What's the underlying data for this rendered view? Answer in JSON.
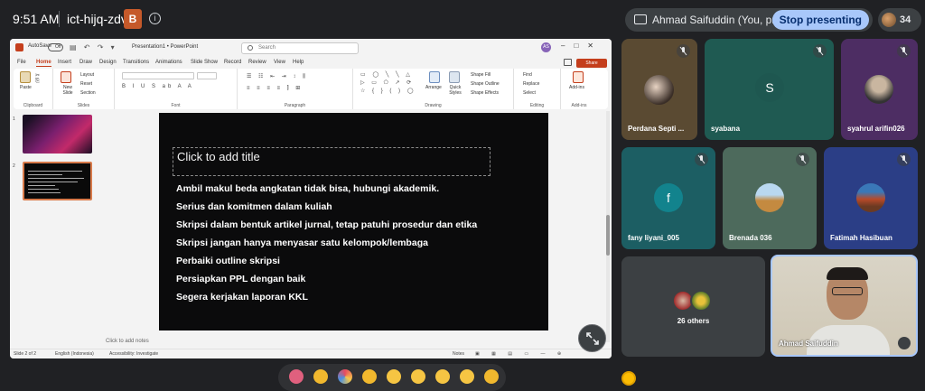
{
  "meeting": {
    "time": "9:51 AM",
    "code": "ict-hijq-zdv",
    "badge": "B",
    "presenting_text": "Ahmad Saifuddin (You, presenting)",
    "stop_label": "Stop presenting",
    "participant_count": "34"
  },
  "ppt": {
    "autosave": "AutoSave",
    "autosave_state": "Off",
    "doc_title": "Presentation1 • PowerPoint",
    "search_placeholder": "Search",
    "avatar": "AS",
    "tabs": [
      "File",
      "Home",
      "Insert",
      "Draw",
      "Design",
      "Transitions",
      "Animations",
      "Slide Show",
      "Record",
      "Review",
      "View",
      "Help"
    ],
    "share": "Share",
    "ribbon": {
      "clipboard": "Clipboard",
      "paste": "Paste",
      "slides": "Slides",
      "new_slide": "New Slide",
      "layout": "Layout",
      "reset": "Reset",
      "section": "Section",
      "font": "Font",
      "paragraph": "Paragraph",
      "drawing": "Drawing",
      "arrange": "Arrange",
      "quick_styles": "Quick Styles",
      "shape_fill": "Shape Fill",
      "shape_outline": "Shape Outline",
      "shape_effects": "Shape Effects",
      "editing": "Editing",
      "find": "Find",
      "replace": "Replace",
      "select": "Select",
      "addins": "Add-ins",
      "addins_btn": "Add-ins"
    },
    "thumb_numbers": [
      "1",
      "2"
    ],
    "slide": {
      "title_placeholder": "Click to add title",
      "bullets": [
        "Ambil makul beda angkatan tidak bisa, hubungi akademik.",
        "Serius dan komitmen dalam kuliah",
        "Skripsi dalam bentuk artikel jurnal, tetap patuhi prosedur dan etika",
        "Skripsi jangan hanya menyasar satu kelompok/lembaga",
        "Perbaiki outline skripsi",
        "Persiapkan PPL dengan baik",
        "Segera kerjakan laporan KKL"
      ]
    },
    "notes_placeholder": "Click to add notes",
    "status": {
      "slide": "Slide 2 of 2",
      "language": "English (Indonesia)",
      "accessibility": "Accessibility: Investigate",
      "notes": "Notes"
    }
  },
  "participants": [
    {
      "name": "Perdana Septi ...",
      "initial": ""
    },
    {
      "name": "syabana",
      "initial": "S"
    },
    {
      "name": "syahrul arifin026",
      "initial": ""
    },
    {
      "name": "fany liyani_005",
      "initial": "f"
    },
    {
      "name": "Brenada 036",
      "initial": ""
    },
    {
      "name": "Fatimah Hasibuan",
      "initial": ""
    }
  ],
  "others": "26 others",
  "self_name": "Ahmad Saifuddin",
  "colors": {
    "accent": "#a8c7fa",
    "ppt_brand": "#c43e1c",
    "background": "#202124"
  }
}
